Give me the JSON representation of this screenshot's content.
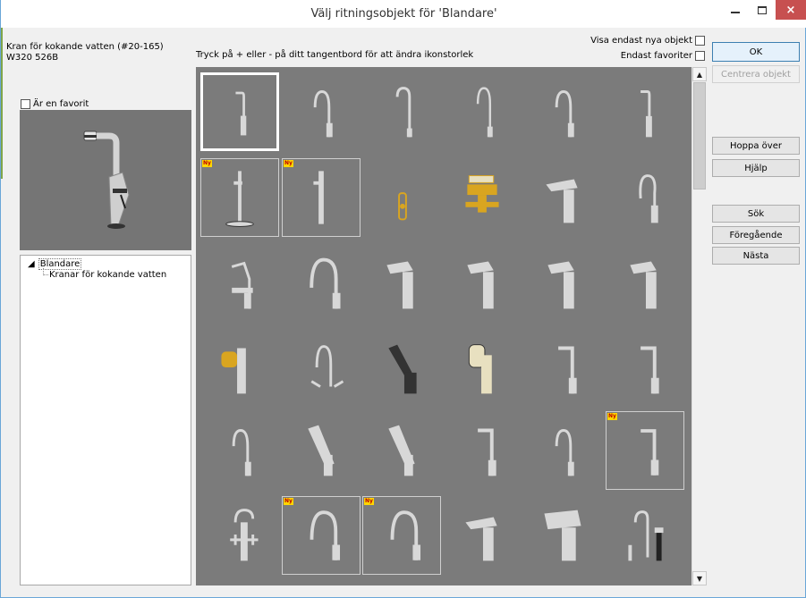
{
  "window": {
    "title": "Välj ritningsobjekt för 'Blandare'",
    "controls": {
      "minimize": "–",
      "maximize": "□",
      "close": "×"
    }
  },
  "selected_object": {
    "name": "Kran för kokande vatten (#20-165)",
    "code": "W320 526B"
  },
  "hint": "Tryck på + eller - på ditt tangentbord för att ändra ikonstorlek",
  "filters": {
    "only_new_label": "Visa endast nya objekt",
    "only_new_checked": false,
    "favorites_label": "Endast favoriter",
    "favorites_checked": false
  },
  "favorite": {
    "label": "Är en favorit",
    "checked": false
  },
  "tree": {
    "root": "Blandare",
    "child": "Kranar för kokande vatten"
  },
  "grid_badge": "Ny",
  "grid": [
    {
      "row": 0,
      "col": 0,
      "icon": "tall-faucet-icon",
      "selected": true,
      "new": false
    },
    {
      "row": 0,
      "col": 1,
      "icon": "curved-faucet-icon",
      "new": false
    },
    {
      "row": 0,
      "col": 2,
      "icon": "hook-faucet-icon",
      "new": false
    },
    {
      "row": 0,
      "col": 3,
      "icon": "slim-faucet-icon",
      "new": false
    },
    {
      "row": 0,
      "col": 4,
      "icon": "curved-faucet-icon",
      "new": false
    },
    {
      "row": 0,
      "col": 5,
      "icon": "tall-faucet-icon",
      "new": false
    },
    {
      "row": 1,
      "col": 0,
      "icon": "floor-faucet-icon",
      "new": true
    },
    {
      "row": 1,
      "col": 1,
      "icon": "pillar-faucet-icon",
      "new": true
    },
    {
      "row": 1,
      "col": 2,
      "icon": "shower-gold-icon",
      "new": false
    },
    {
      "row": 1,
      "col": 3,
      "icon": "bath-mixer-gold-icon",
      "new": false
    },
    {
      "row": 1,
      "col": 4,
      "icon": "short-mixer-icon",
      "new": false
    },
    {
      "row": 1,
      "col": 5,
      "icon": "loop-faucet-icon",
      "new": false
    },
    {
      "row": 2,
      "col": 0,
      "icon": "pull-out-faucet-icon",
      "new": false
    },
    {
      "row": 2,
      "col": 1,
      "icon": "arc-faucet-icon",
      "new": false
    },
    {
      "row": 2,
      "col": 2,
      "icon": "lever-mixer-icon",
      "new": false
    },
    {
      "row": 2,
      "col": 3,
      "icon": "lever-mixer-icon",
      "new": false
    },
    {
      "row": 2,
      "col": 4,
      "icon": "lever-mixer-icon",
      "new": false
    },
    {
      "row": 2,
      "col": 5,
      "icon": "lever-mixer-icon",
      "new": false
    },
    {
      "row": 3,
      "col": 0,
      "icon": "gold-spray-mixer-icon",
      "new": false
    },
    {
      "row": 3,
      "col": 1,
      "icon": "twin-handle-faucet-icon",
      "new": false
    },
    {
      "row": 3,
      "col": 2,
      "icon": "black-mixer-icon",
      "new": false
    },
    {
      "row": 3,
      "col": 3,
      "icon": "beige-spray-mixer-icon",
      "new": false
    },
    {
      "row": 3,
      "col": 4,
      "icon": "square-faucet-icon",
      "new": false
    },
    {
      "row": 3,
      "col": 5,
      "icon": "square-faucet-icon",
      "new": false
    },
    {
      "row": 4,
      "col": 0,
      "icon": "curved-faucet-icon",
      "new": false
    },
    {
      "row": 4,
      "col": 1,
      "icon": "tilted-mixer-icon",
      "new": false
    },
    {
      "row": 4,
      "col": 2,
      "icon": "tilted-mixer-icon",
      "new": false
    },
    {
      "row": 4,
      "col": 3,
      "icon": "square-faucet-icon",
      "new": false
    },
    {
      "row": 4,
      "col": 4,
      "icon": "curved-faucet-icon",
      "new": false
    },
    {
      "row": 4,
      "col": 5,
      "icon": "square-faucet-icon",
      "new": true
    },
    {
      "row": 5,
      "col": 0,
      "icon": "vintage-cross-faucet-icon",
      "new": false
    },
    {
      "row": 5,
      "col": 1,
      "icon": "arc-faucet-icon",
      "new": true
    },
    {
      "row": 5,
      "col": 2,
      "icon": "arc-faucet-icon",
      "new": true
    },
    {
      "row": 5,
      "col": 3,
      "icon": "short-mixer-icon",
      "new": false
    },
    {
      "row": 5,
      "col": 4,
      "icon": "wide-mixer-icon",
      "new": false
    },
    {
      "row": 5,
      "col": 5,
      "icon": "faucet-set-icon",
      "new": false
    }
  ],
  "buttons": {
    "ok": "OK",
    "center": "Centrera objekt",
    "skip": "Hoppa över",
    "help": "Hjälp",
    "search": "Sök",
    "previous": "Föregående",
    "next": "Nästa"
  },
  "colors": {
    "grid_bg": "#7b7b7b",
    "faucet": "#d8d8d8",
    "gold": "#d9a520",
    "badge": "#ffd700"
  }
}
